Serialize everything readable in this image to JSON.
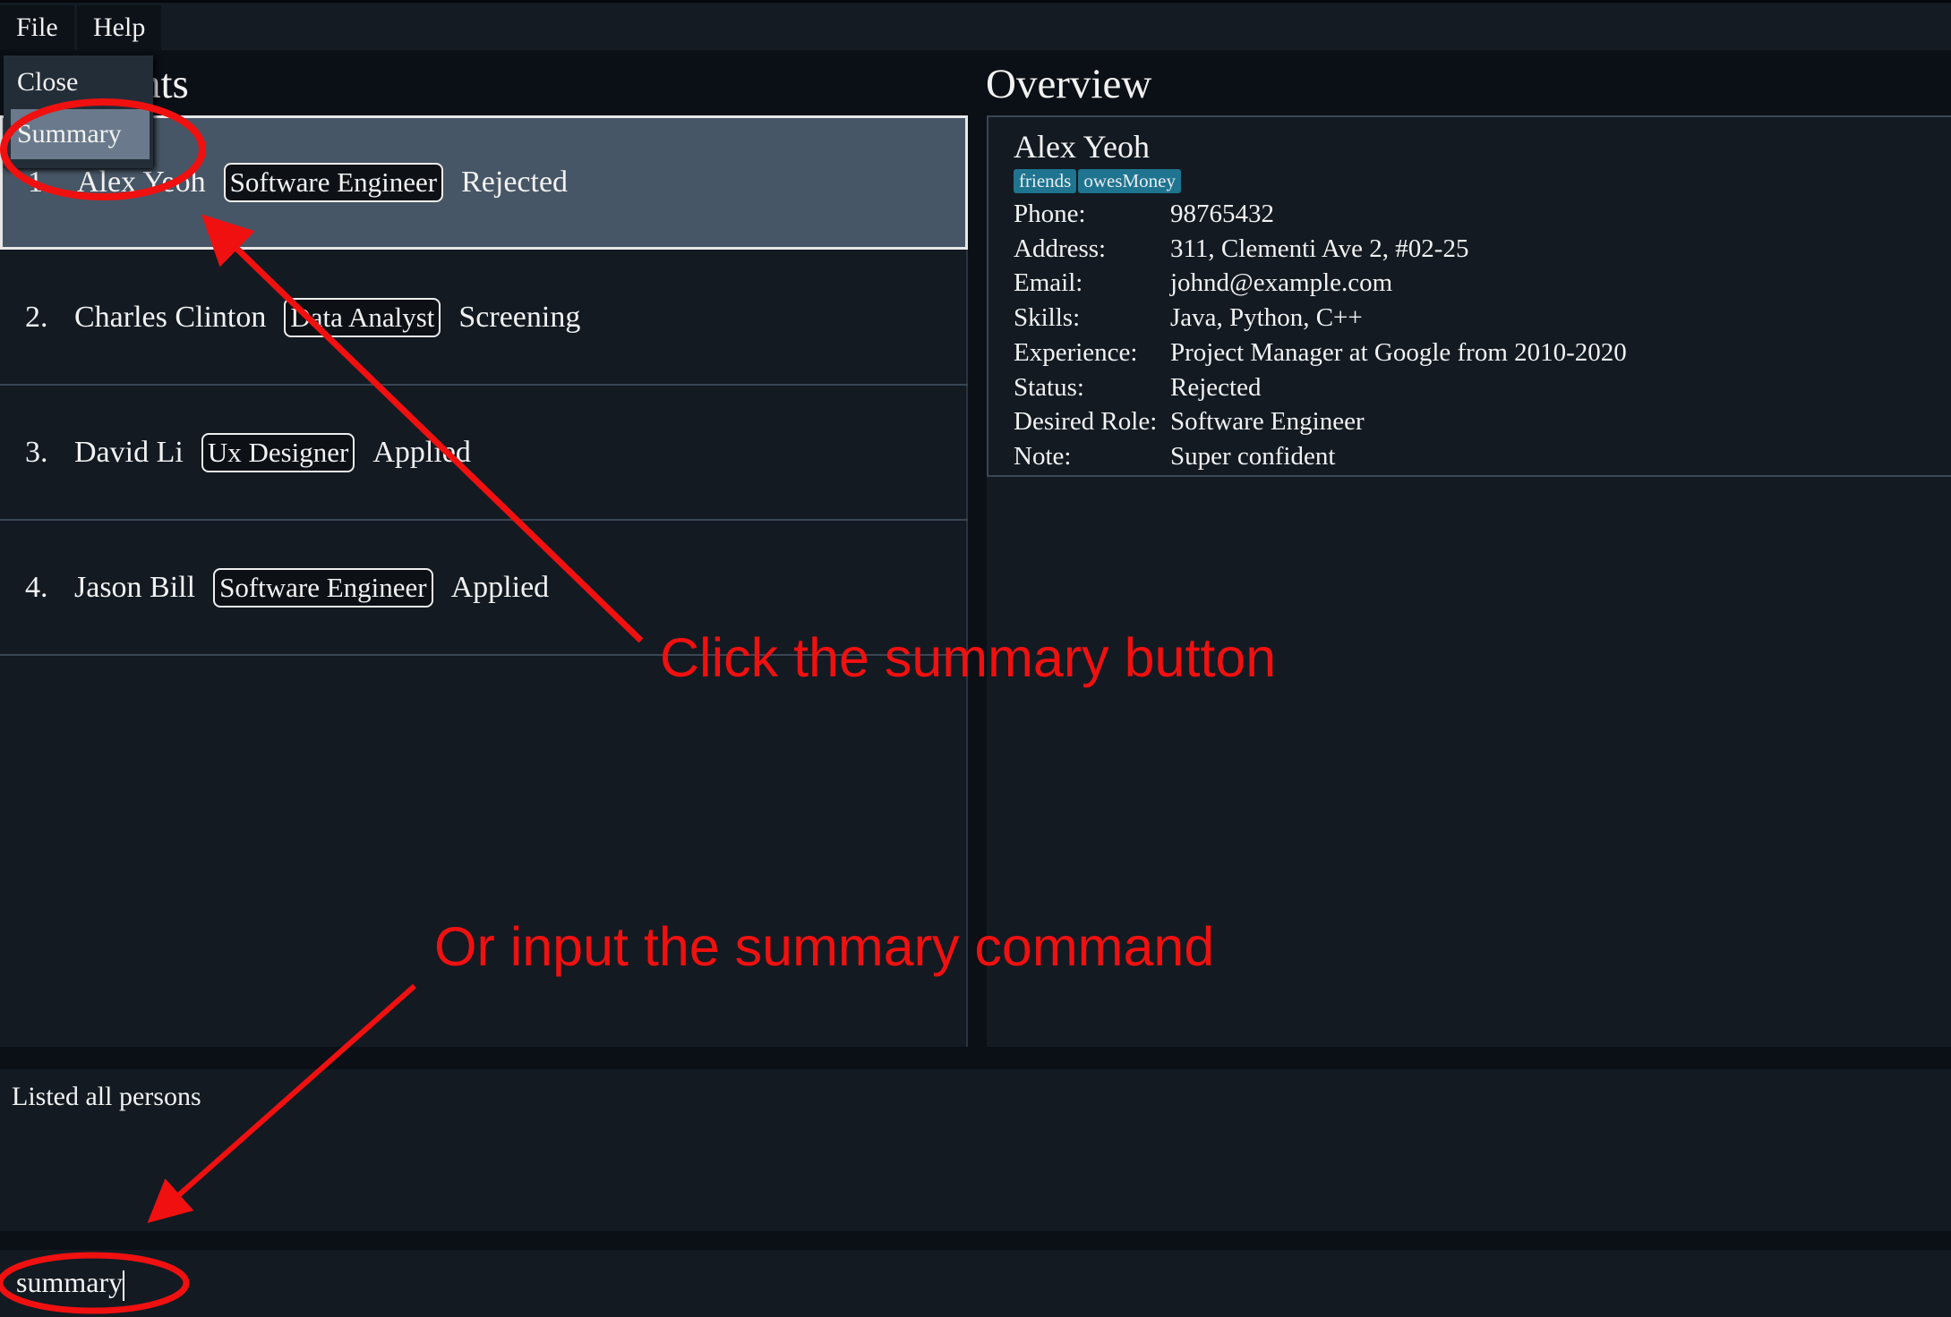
{
  "menu": {
    "file": "File",
    "help": "Help",
    "dropdown": [
      "Close",
      "Summary"
    ]
  },
  "left": {
    "title": "Applicants",
    "title_visible": "nts",
    "rows": [
      {
        "index": "1.",
        "name": "Alex Yeoh",
        "role": "Software Engineer",
        "status": "Rejected"
      },
      {
        "index": "2.",
        "name": "Charles Clinton",
        "role": "Data Analyst",
        "status": "Screening"
      },
      {
        "index": "3.",
        "name": "David Li",
        "role": "Ux Designer",
        "status": "Applied"
      },
      {
        "index": "4.",
        "name": "Jason Bill",
        "role": "Software Engineer",
        "status": "Applied"
      }
    ]
  },
  "overview": {
    "title": "Overview",
    "name": "Alex Yeoh",
    "tags": [
      "friends",
      "owesMoney"
    ],
    "details": [
      {
        "label": "Phone:",
        "value": "98765432"
      },
      {
        "label": "Address:",
        "value": "311, Clementi Ave 2, #02-25"
      },
      {
        "label": "Email:",
        "value": "johnd@example.com"
      },
      {
        "label": "Skills:",
        "value": "Java, Python, C++"
      },
      {
        "label": "Experience:",
        "value": "Project Manager at Google from 2010-2020"
      },
      {
        "label": "Status:",
        "value": "Rejected"
      },
      {
        "label": "Desired Role:",
        "value": "Software Engineer"
      },
      {
        "label": "Note:",
        "value": "Super confident"
      }
    ]
  },
  "result": "Listed all persons",
  "command": "summary",
  "annotations": {
    "a1": "Click the summary button",
    "a2": "Or input the summary command",
    "color": "#f01010"
  },
  "colors": {
    "selected_row": "#475666",
    "tag": "#1f7490",
    "background": "#131a22"
  }
}
